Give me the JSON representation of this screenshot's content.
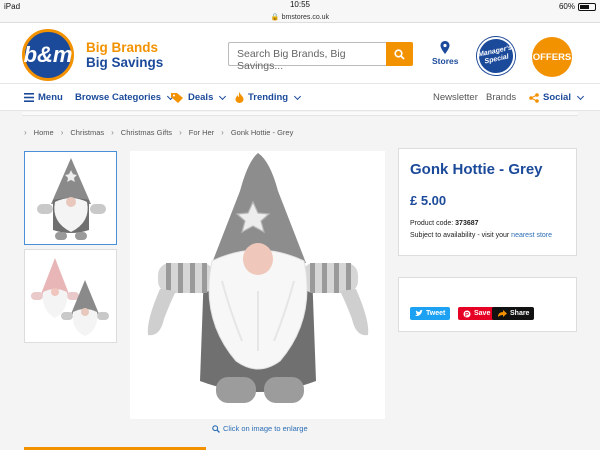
{
  "status_bar": {
    "device": "iPad",
    "time": "10:55",
    "url": "bmstores.co.uk",
    "battery": "60%"
  },
  "header": {
    "logo_text": "b&m",
    "tagline_line1": "Big Brands",
    "tagline_line2": "Big Savings",
    "search_placeholder": "Search Big Brands, Big Savings...",
    "stores_label": "Stores",
    "managers_special": "Manager's Special",
    "offers_label": "OFFERS"
  },
  "nav": {
    "menu": "Menu",
    "browse": "Browse Categories",
    "deals": "Deals",
    "trending": "Trending",
    "newsletter": "Newsletter",
    "brands": "Brands",
    "social": "Social"
  },
  "breadcrumb": [
    "Home",
    "Christmas",
    "Christmas Gifts",
    "For Her",
    "Gonk Hottie - Grey"
  ],
  "product": {
    "title": "Gonk Hottie - Grey",
    "price": "£ 5.00",
    "code_label": "Product code:",
    "code": "373687",
    "availability": "Subject to availability - visit your",
    "store_link": "nearest store",
    "enlarge_hint": "Click on image to enlarge"
  },
  "share": {
    "tweet": "Tweet",
    "save": "Save",
    "share": "Share"
  },
  "colors": {
    "brand_blue": "#1c4a9a",
    "brand_orange": "#f39200",
    "link_blue": "#2a6db5"
  }
}
